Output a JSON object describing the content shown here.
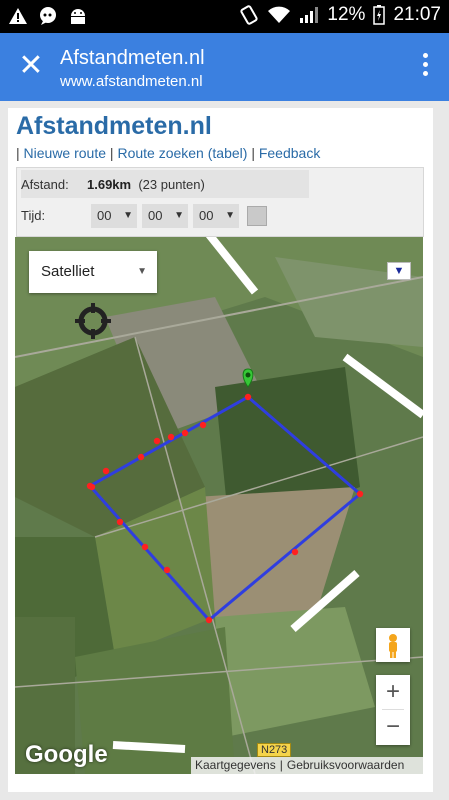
{
  "status_bar": {
    "battery_percent": "12%",
    "time": "21:07",
    "icons": [
      "warning-icon",
      "chat-icon",
      "android-icon",
      "vibrate-icon",
      "wifi-icon",
      "signal-icon",
      "battery-icon"
    ]
  },
  "app_bar": {
    "title": "Afstandmeten.nl",
    "url": "www.afstandmeten.nl",
    "close_icon": "close-icon",
    "menu_icon": "more-vert-icon"
  },
  "page": {
    "title": "Afstandmeten.nl",
    "links": [
      "Nieuwe route",
      "Route zoeken (tabel)",
      "Feedback"
    ],
    "separator": "|"
  },
  "panel": {
    "distance_label": "Afstand:",
    "distance_value": "1.69km",
    "points": "(23 punten)",
    "time_label": "Tijd:",
    "hours": "00",
    "minutes": "00",
    "seconds": "00"
  },
  "map": {
    "type_selected": "Satelliet",
    "road_label": "N273",
    "google": "Google",
    "attribution": [
      "Kaartgegevens",
      "Gebruiksvoorwaarden"
    ],
    "route_color": "#2f3ee0",
    "point_color": "#ff2020",
    "marker_color": "#36c836",
    "route_points": 23
  }
}
